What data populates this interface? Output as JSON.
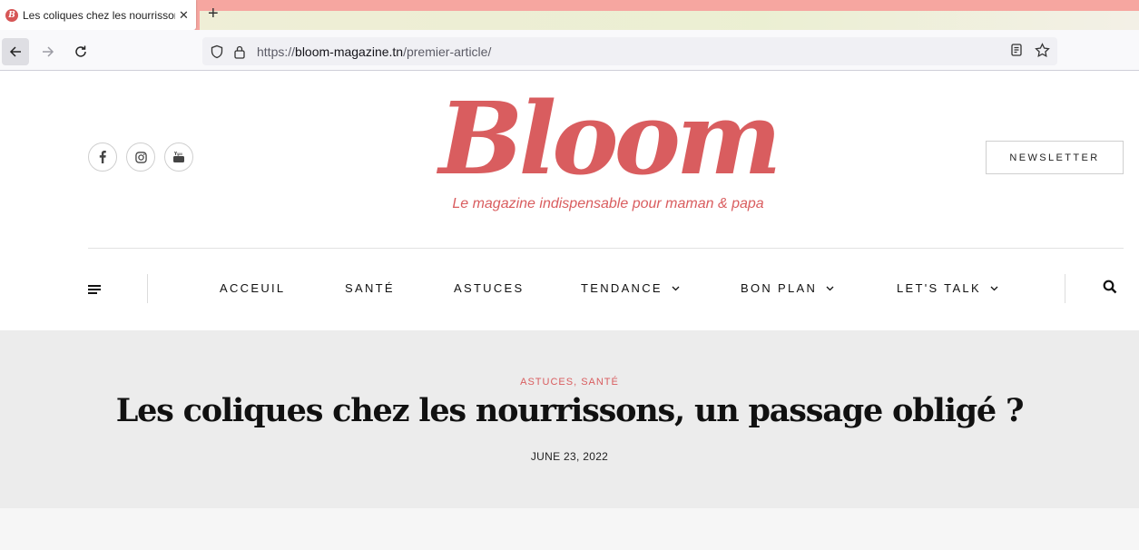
{
  "browser": {
    "tab_title": "Les coliques chez les nourrissons, un passage obligé ?",
    "favicon_letter": "B",
    "url_scheme": "https://",
    "url_domain": "bloom-magazine.tn",
    "url_path": "/premier-article/"
  },
  "site": {
    "logo": "Bloom",
    "tagline": "Le magazine indispensable pour maman & papa",
    "newsletter_label": "NEWSLETTER",
    "social": [
      "facebook-icon",
      "instagram-icon",
      "youtube-icon"
    ],
    "accent_color": "#d95d5f"
  },
  "menu": {
    "items": [
      {
        "label": "ACCEUIL",
        "dropdown": false
      },
      {
        "label": "SANTÉ",
        "dropdown": false
      },
      {
        "label": "ASTUCES",
        "dropdown": false
      },
      {
        "label": "TENDANCE",
        "dropdown": true
      },
      {
        "label": "BON PLAN",
        "dropdown": true
      },
      {
        "label": "LET'S TALK",
        "dropdown": true
      }
    ]
  },
  "article": {
    "categories": "ASTUCES, SANTÉ",
    "title": "Les coliques chez les nourrissons, un passage obligé ?",
    "date": "JUNE 23, 2022"
  }
}
